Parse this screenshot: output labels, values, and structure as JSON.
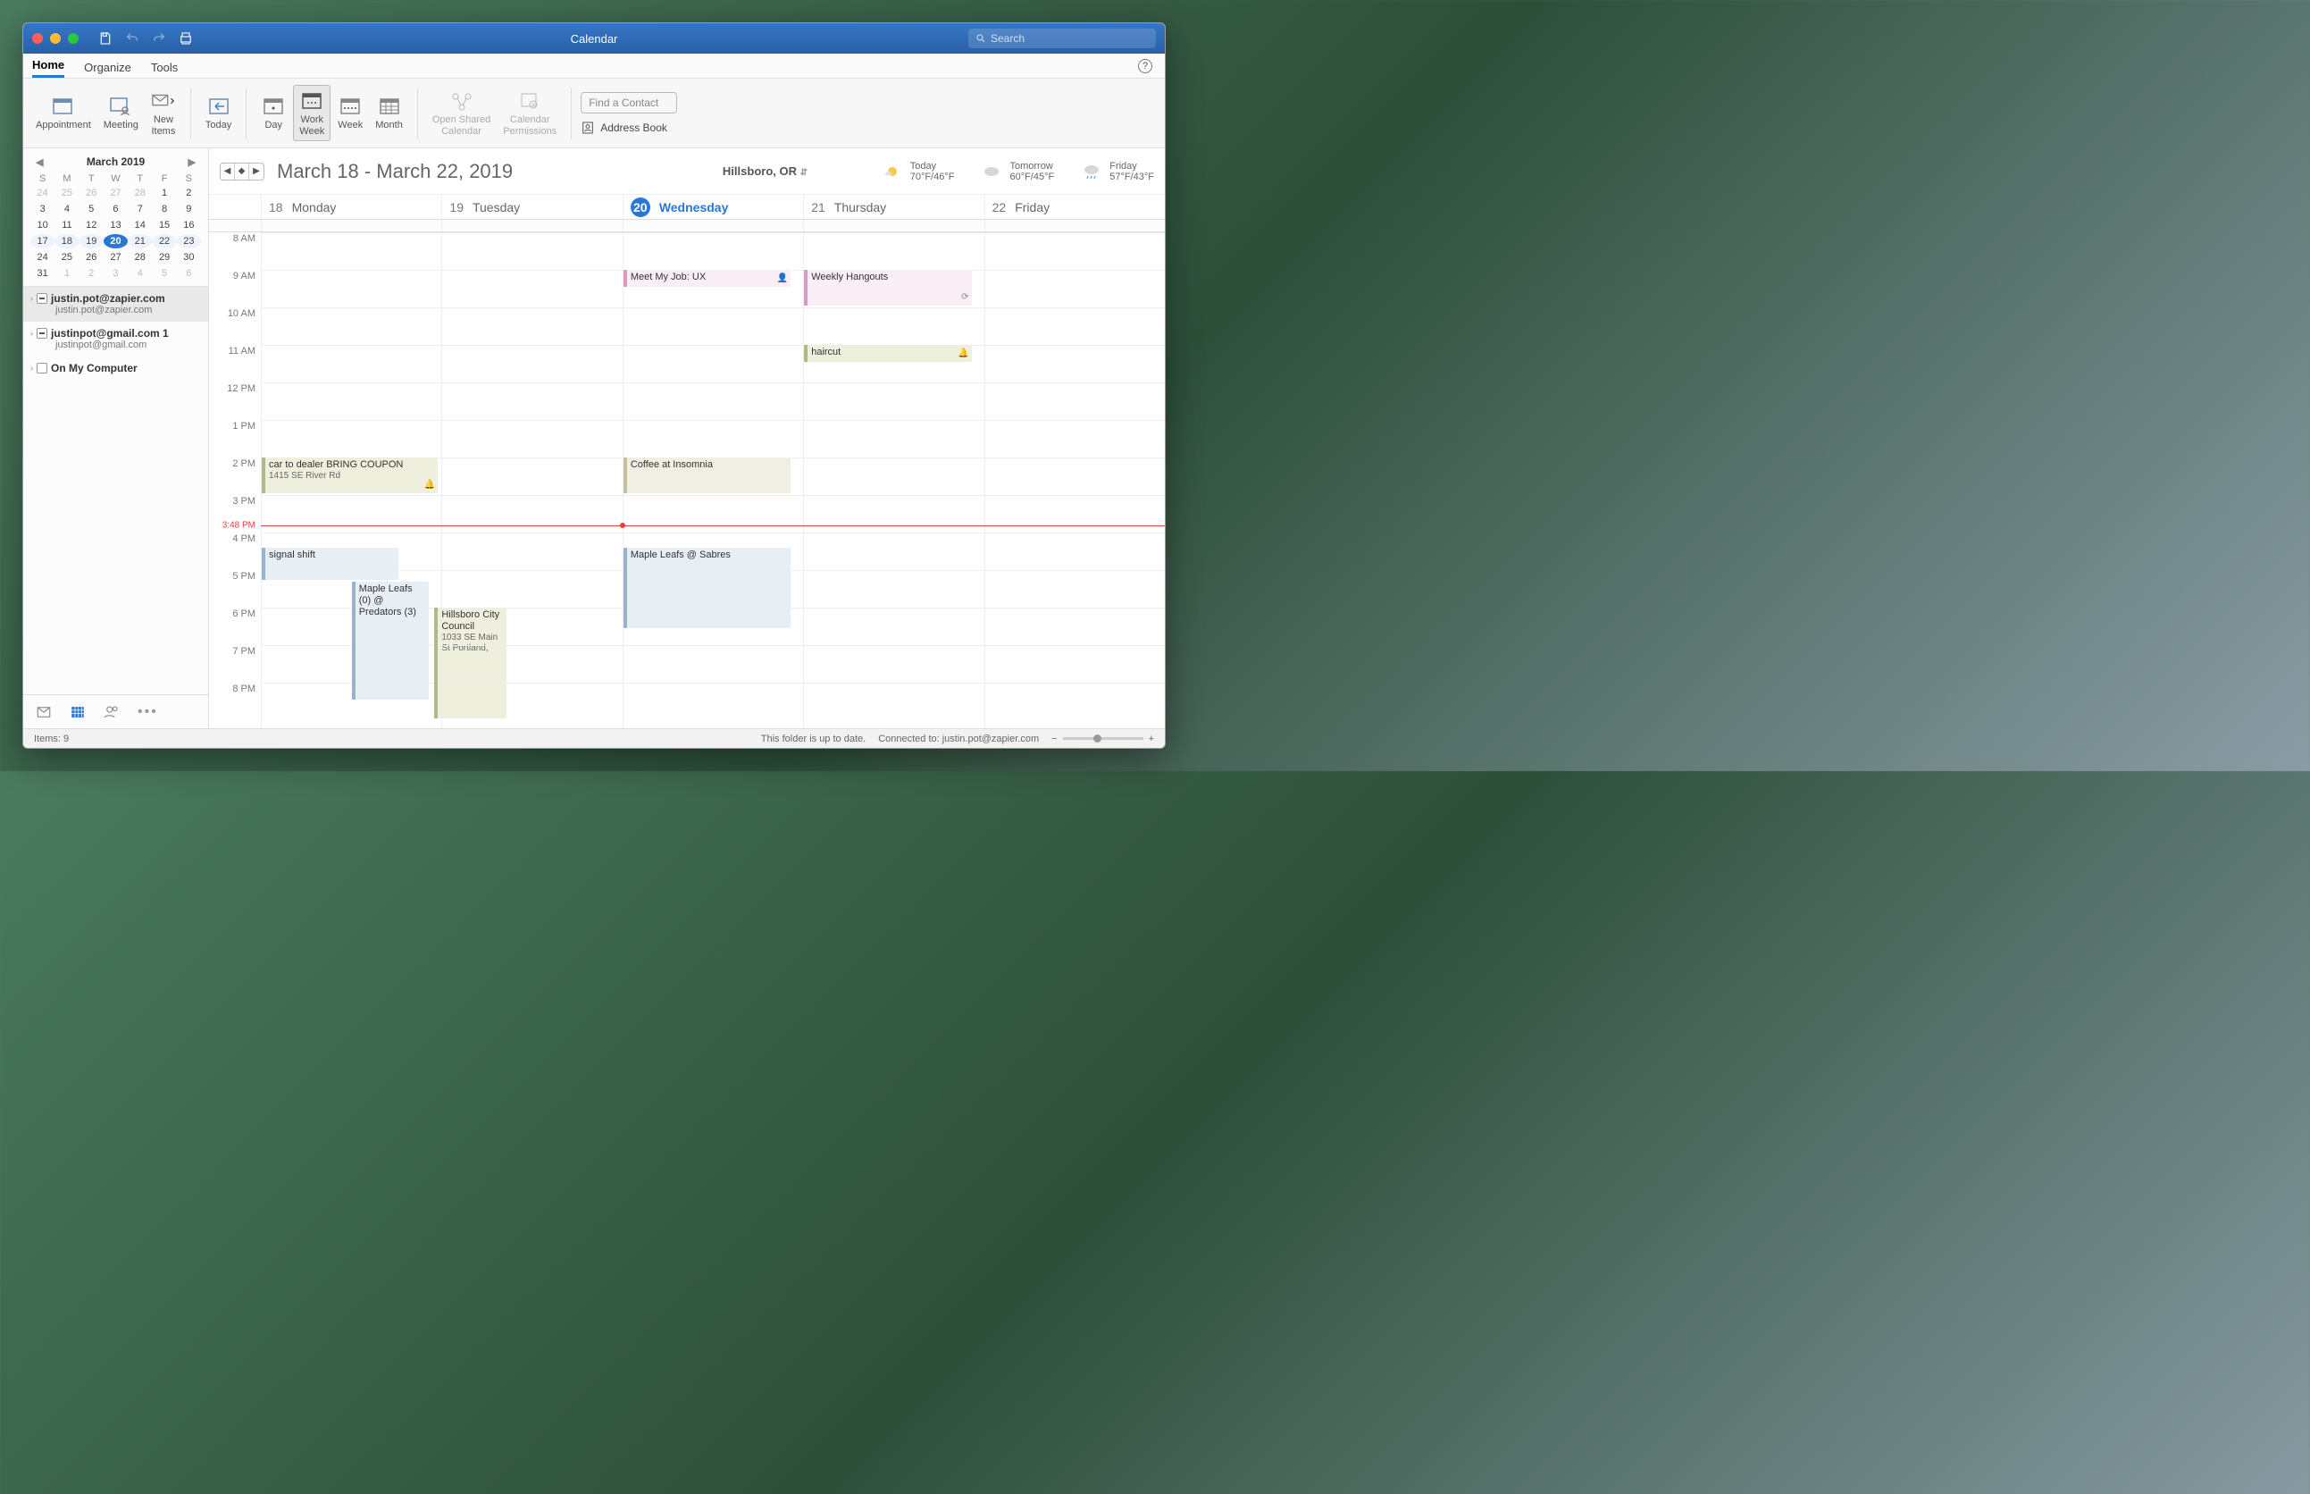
{
  "titlebar": {
    "title": "Calendar",
    "search_placeholder": "Search"
  },
  "tabs": {
    "home": "Home",
    "organize": "Organize",
    "tools": "Tools"
  },
  "ribbon": {
    "appointment": "Appointment",
    "meeting": "Meeting",
    "newitems": "New\nItems",
    "today": "Today",
    "day": "Day",
    "workweek": "Work\nWeek",
    "week": "Week",
    "month": "Month",
    "openshared": "Open Shared\nCalendar",
    "perms": "Calendar\nPermissions",
    "find": "Find a Contact",
    "addressbook": "Address Book"
  },
  "minical": {
    "title": "March 2019",
    "dow": [
      "S",
      "M",
      "T",
      "W",
      "T",
      "F",
      "S"
    ],
    "weeks": [
      [
        {
          "d": "24",
          "o": true
        },
        {
          "d": "25",
          "o": true
        },
        {
          "d": "26",
          "o": true
        },
        {
          "d": "27",
          "o": true
        },
        {
          "d": "28",
          "o": true
        },
        {
          "d": "1"
        },
        {
          "d": "2"
        }
      ],
      [
        {
          "d": "3"
        },
        {
          "d": "4"
        },
        {
          "d": "5"
        },
        {
          "d": "6"
        },
        {
          "d": "7"
        },
        {
          "d": "8"
        },
        {
          "d": "9"
        }
      ],
      [
        {
          "d": "10"
        },
        {
          "d": "11"
        },
        {
          "d": "12"
        },
        {
          "d": "13"
        },
        {
          "d": "14"
        },
        {
          "d": "15"
        },
        {
          "d": "16"
        }
      ],
      [
        {
          "d": "17"
        },
        {
          "d": "18"
        },
        {
          "d": "19"
        },
        {
          "d": "20",
          "today": true
        },
        {
          "d": "21"
        },
        {
          "d": "22"
        },
        {
          "d": "23"
        }
      ],
      [
        {
          "d": "24"
        },
        {
          "d": "25"
        },
        {
          "d": "26"
        },
        {
          "d": "27"
        },
        {
          "d": "28"
        },
        {
          "d": "29"
        },
        {
          "d": "30"
        }
      ],
      [
        {
          "d": "31"
        },
        {
          "d": "1",
          "o": true
        },
        {
          "d": "2",
          "o": true
        },
        {
          "d": "3",
          "o": true
        },
        {
          "d": "4",
          "o": true
        },
        {
          "d": "5",
          "o": true
        },
        {
          "d": "6",
          "o": true
        }
      ]
    ]
  },
  "accounts": [
    {
      "name": "justin.pot@zapier.com",
      "sub": "justin.pot@zapier.com",
      "selected": true,
      "minus": true
    },
    {
      "name": "justinpot@gmail.com 1",
      "sub": "justinpot@gmail.com",
      "selected": false,
      "minus": true
    },
    {
      "name": "On My Computer",
      "sub": "",
      "selected": false,
      "minus": false
    }
  ],
  "header": {
    "range": "March 18 - March 22, 2019",
    "location": "Hillsboro, OR",
    "weather": [
      {
        "day": "Today",
        "temp": "70°F/46°F"
      },
      {
        "day": "Tomorrow",
        "temp": "60°F/45°F"
      },
      {
        "day": "Friday",
        "temp": "57°F/43°F"
      }
    ]
  },
  "days": [
    {
      "num": "18",
      "name": "Monday"
    },
    {
      "num": "19",
      "name": "Tuesday"
    },
    {
      "num": "20",
      "name": "Wednesday",
      "today": true
    },
    {
      "num": "21",
      "name": "Thursday"
    },
    {
      "num": "22",
      "name": "Friday"
    }
  ],
  "hours": [
    "8 AM",
    "9 AM",
    "10 AM",
    "11 AM",
    "12 PM",
    "1 PM",
    "2 PM",
    "3 PM",
    "4 PM",
    "5 PM",
    "6 PM",
    "7 PM",
    "8 PM"
  ],
  "now": {
    "label": "3:48 PM",
    "offset_hours": 7.8
  },
  "events": [
    {
      "col": 0,
      "start": 6.0,
      "dur": 1.0,
      "cls": "ev-green",
      "title": "car to dealer BRING COUPON",
      "sub": "1415 SE River Rd",
      "bell": true,
      "w": 1.0
    },
    {
      "col": 0,
      "start": 8.4,
      "dur": 0.9,
      "cls": "ev-blue",
      "title": "signal shift",
      "w": 0.78
    },
    {
      "col": 0,
      "start": 9.3,
      "dur": 3.2,
      "cls": "ev-blue",
      "title": "Maple Leafs (0) @ Predators (3)",
      "w": 0.45,
      "left": 0.5
    },
    {
      "col": 0,
      "start": 10.0,
      "dur": 3.0,
      "cls": "ev-green",
      "title": "Hillsboro City Council",
      "sub": "1033 SE Main St Portland,",
      "w": 0.42,
      "left": 0.96
    },
    {
      "col": 2,
      "start": 1.0,
      "dur": 0.5,
      "cls": "ev-pink",
      "title": "Meet My Job: UX",
      "person": true,
      "w": 0.95
    },
    {
      "col": 2,
      "start": 6.0,
      "dur": 1.0,
      "cls": "ev-tan",
      "title": "Coffee at Insomnia",
      "w": 0.95
    },
    {
      "col": 2,
      "start": 8.4,
      "dur": 2.2,
      "cls": "ev-blue",
      "title": "Maple Leafs @ Sabres",
      "w": 0.95
    },
    {
      "col": 3,
      "start": 1.0,
      "dur": 1.0,
      "cls": "ev-pink",
      "title": "Weekly Hangouts",
      "recur": true,
      "w": 0.95
    },
    {
      "col": 3,
      "start": 3.0,
      "dur": 0.5,
      "cls": "ev-green",
      "title": "haircut",
      "bell": true,
      "w": 0.95
    }
  ],
  "status": {
    "items": "Items: 9",
    "folder": "This folder is up to date.",
    "connected": "Connected to: justin.pot@zapier.com"
  }
}
